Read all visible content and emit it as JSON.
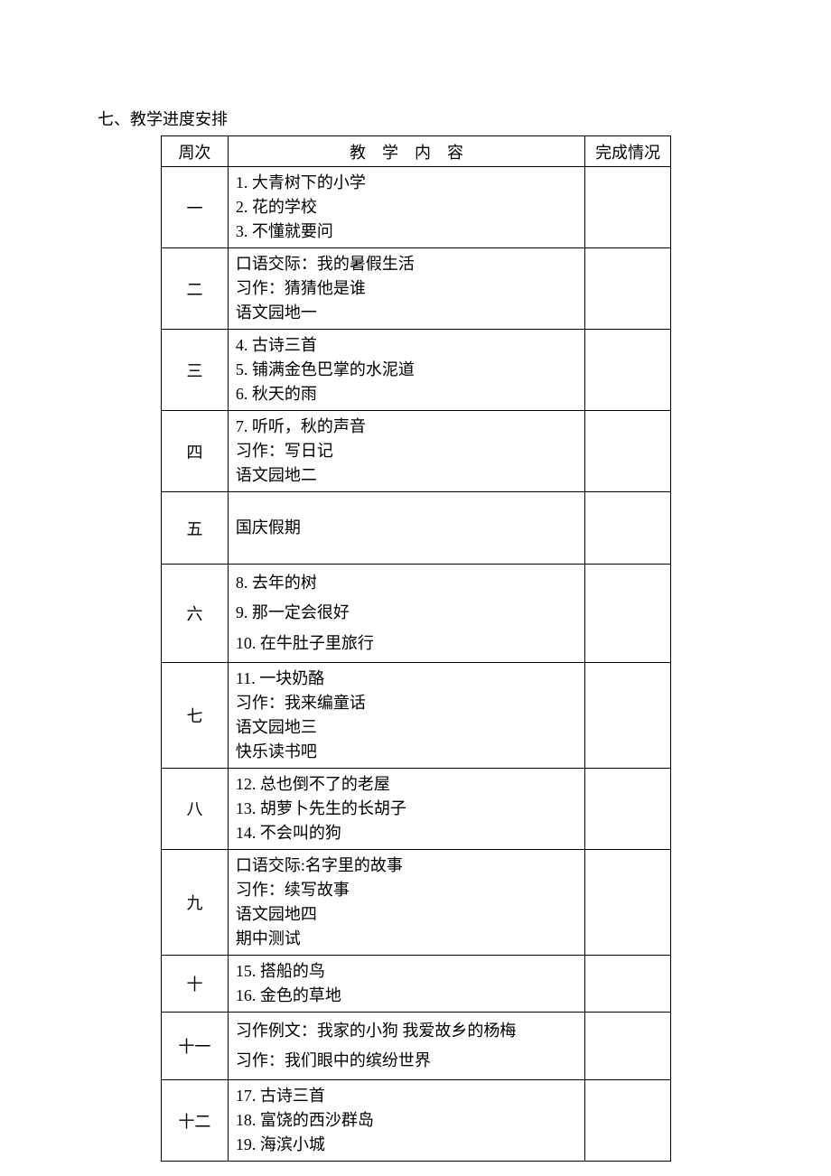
{
  "heading": "七、教学进度安排",
  "headers": {
    "week": "周次",
    "content": "教学内容",
    "status": "完成情况"
  },
  "rows": [
    {
      "week": "一",
      "content": "1. 大青树下的小学\n2. 花的学校\n3. 不懂就要问",
      "status": "",
      "cls": ""
    },
    {
      "week": "二",
      "content": "口语交际：我的暑假生活\n习作：猜猜他是谁\n语文园地一",
      "status": "",
      "cls": ""
    },
    {
      "week": "三",
      "content": "4. 古诗三首\n5. 铺满金色巴掌的水泥道\n6. 秋天的雨",
      "status": "",
      "cls": ""
    },
    {
      "week": "四",
      "content": "7. 听听，秋的声音\n习作：写日记\n语文园地二",
      "status": "",
      "cls": ""
    },
    {
      "week": "五",
      "content": "国庆假期",
      "status": "",
      "cls": "tall-single"
    },
    {
      "week": "六",
      "content": "8. 去年的树\n9. 那一定会很好\n10. 在牛肚子里旅行",
      "status": "",
      "cls": "loose"
    },
    {
      "week": "七",
      "content": "11. 一块奶酪\n习作：我来编童话\n语文园地三\n快乐读书吧",
      "status": "",
      "cls": ""
    },
    {
      "week": "八",
      "content": "12. 总也倒不了的老屋\n13. 胡萝卜先生的长胡子\n14. 不会叫的狗",
      "status": "",
      "cls": ""
    },
    {
      "week": "九",
      "content": "口语交际:名字里的故事\n习作：续写故事\n语文园地四\n期中测试",
      "status": "",
      "cls": ""
    },
    {
      "week": "十",
      "content": "15. 搭船的鸟\n16. 金色的草地",
      "status": "",
      "cls": ""
    },
    {
      "week": "十一",
      "content": "习作例文：我家的小狗  我爱故乡的杨梅\n习作：我们眼中的缤纷世界",
      "status": "",
      "cls": "loose"
    },
    {
      "week": "十二",
      "content": "17. 古诗三首\n18. 富饶的西沙群岛\n19. 海滨小城",
      "status": "",
      "cls": ""
    }
  ]
}
